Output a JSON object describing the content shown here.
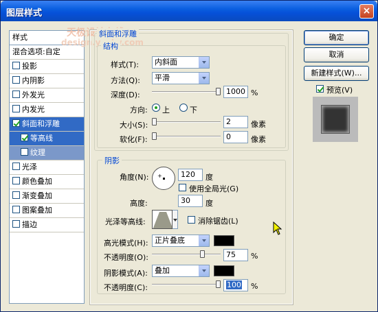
{
  "window": {
    "title": "图层样式",
    "close": "×"
  },
  "watermark": {
    "line1": "天极设计在线",
    "line2": "design.yesky.com"
  },
  "left_list": {
    "header": "样式",
    "blend": "混合选项:自定",
    "items": [
      {
        "label": "投影",
        "checked": false
      },
      {
        "label": "内阴影",
        "checked": false
      },
      {
        "label": "外发光",
        "checked": false
      },
      {
        "label": "内发光",
        "checked": false
      },
      {
        "label": "斜面和浮雕",
        "checked": true,
        "selected": true
      },
      {
        "label": "等高线",
        "checked": true,
        "sub": true,
        "selected": true
      },
      {
        "label": "纹理",
        "checked": false,
        "sub": true
      },
      {
        "label": "光泽",
        "checked": false
      },
      {
        "label": "颜色叠加",
        "checked": false
      },
      {
        "label": "渐变叠加",
        "checked": false
      },
      {
        "label": "图案叠加",
        "checked": false
      },
      {
        "label": "描边",
        "checked": false
      }
    ]
  },
  "bevel": {
    "section_title": "斜面和浮雕",
    "structure_title": "结构",
    "style_label": "样式(T):",
    "style_value": "内斜面",
    "technique_label": "方法(Q):",
    "technique_value": "平滑",
    "depth_label": "深度(D):",
    "depth_value": "1000",
    "depth_unit": "%",
    "depth_level": 1.0,
    "direction_label": "方向:",
    "dir_up": "上",
    "dir_down": "下",
    "size_label": "大小(S):",
    "size_value": "2",
    "size_unit": "像素",
    "size_level": 0.0,
    "soften_label": "软化(F):",
    "soften_value": "0",
    "soften_unit": "像素",
    "soften_level": 0.0
  },
  "shading": {
    "title": "阴影",
    "angle_label": "角度(N):",
    "angle_value": "120",
    "angle_unit": "度",
    "global_light": "使用全局光(G)",
    "altitude_label": "高度:",
    "altitude_value": "30",
    "altitude_unit": "度",
    "gloss_label": "光泽等高线:",
    "antialias": "消除锯齿(L)",
    "highlight_mode_label": "高光模式(H):",
    "highlight_mode_value": "正片叠底",
    "highlight_color": "#000000",
    "highlight_opacity_label": "不透明度(O):",
    "highlight_opacity_value": "75",
    "highlight_opacity_level": 0.75,
    "highlight_opacity_unit": "%",
    "shadow_mode_label": "阴影模式(A):",
    "shadow_mode_value": "叠加",
    "shadow_color": "#000000",
    "shadow_opacity_label": "不透明度(C):",
    "shadow_opacity_value": "100",
    "shadow_opacity_level": 1.0,
    "shadow_opacity_unit": "%"
  },
  "buttons": {
    "ok": "确定",
    "cancel": "取消",
    "new_style": "新建样式(W)...",
    "preview": "预览(V)"
  }
}
